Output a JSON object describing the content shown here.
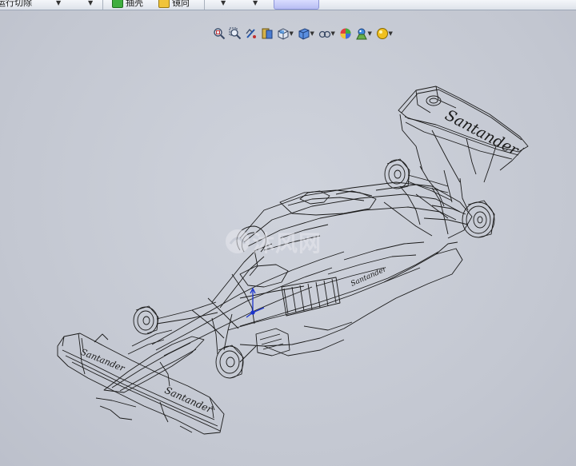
{
  "toolbar": {
    "items": [
      {
        "label": "运行切除"
      },
      {
        "label": "抽壳"
      },
      {
        "label": "镜向"
      }
    ]
  },
  "view_tools": [
    {
      "icon": "zoom-to-fit-icon"
    },
    {
      "icon": "zoom-to-area-icon"
    },
    {
      "icon": "previous-view-icon"
    },
    {
      "icon": "section-view-icon"
    },
    {
      "icon": "view-orientation-icon"
    },
    {
      "icon": "display-style-icon"
    },
    {
      "icon": "hide-show-items-icon"
    },
    {
      "icon": "edit-appearance-icon"
    },
    {
      "icon": "apply-scene-icon"
    },
    {
      "icon": "view-settings-icon"
    }
  ],
  "model": {
    "rear_wing_text": "Santander",
    "front_wing_left_text": "Santander",
    "front_wing_right_text": "Santander",
    "sidepod_text": "Santander"
  },
  "watermark": {
    "text": "沐风网"
  },
  "colors": {
    "viewport_bg": "#c6cad4",
    "wireframe": "#1a1a1a",
    "triad": "#1a33cc"
  }
}
